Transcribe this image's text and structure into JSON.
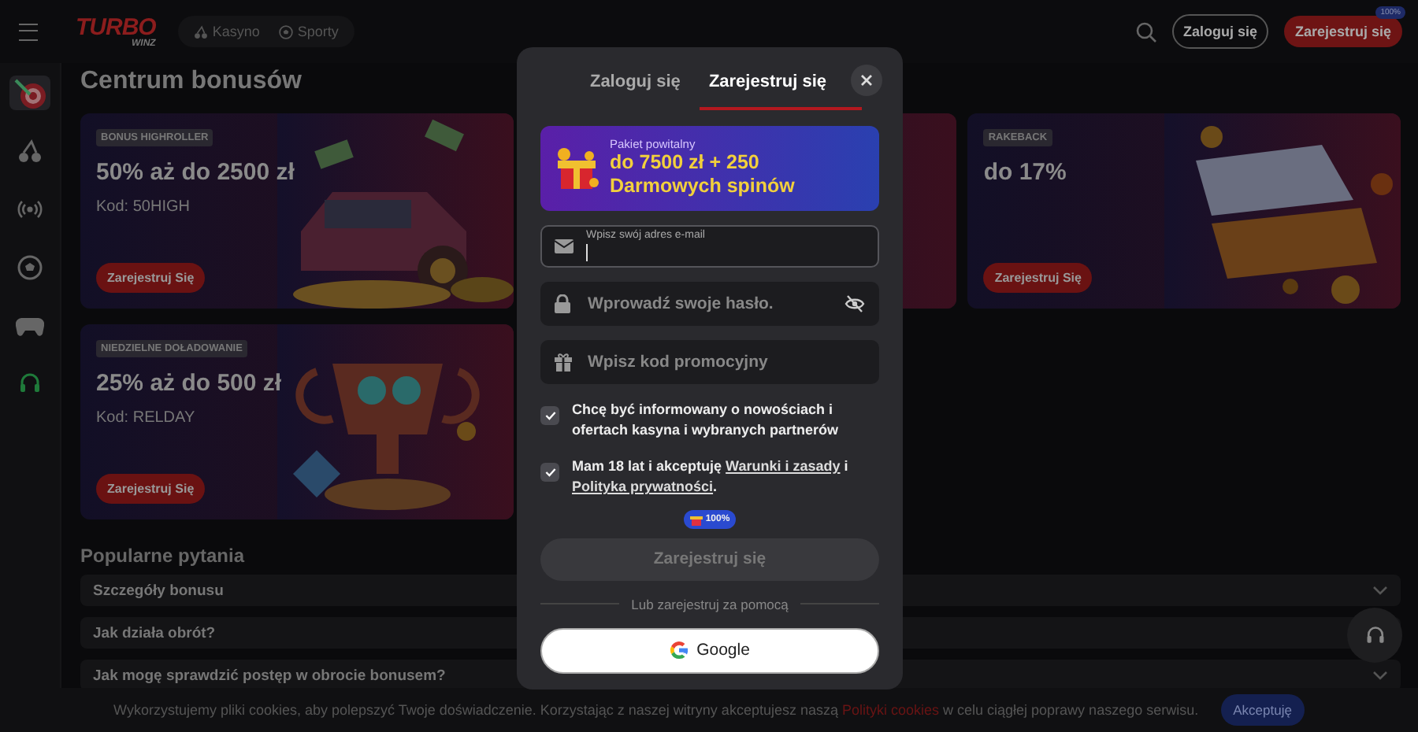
{
  "header": {
    "logo": {
      "top": "TURBO",
      "bottom": "WINZ"
    },
    "nav": [
      {
        "label": "Kasyno",
        "kind": "casino"
      },
      {
        "label": "Sporty",
        "kind": "sport"
      }
    ],
    "login": "Zaloguj się",
    "register": "Zarejestruj się",
    "register_badge": "100%"
  },
  "sidebar": {
    "items": [
      {
        "kind": "target",
        "selected": true
      },
      {
        "kind": "cherries",
        "selected": false
      },
      {
        "kind": "live",
        "selected": false
      },
      {
        "kind": "ball",
        "selected": false
      },
      {
        "kind": "gamepad",
        "selected": false
      },
      {
        "kind": "headset",
        "selected": false
      }
    ]
  },
  "page_title": "Centrum bonusów",
  "cards": [
    {
      "tag": "BONUS HIGHROLLER",
      "title": "50% aż do 2500 zł",
      "code": "Kod: 50HIGH",
      "button": "Zarejestruj Się"
    },
    {
      "kind": "picture"
    },
    {
      "tag": "RAKEBACK",
      "title": "do 17%",
      "button": "Zarejestruj Się"
    },
    {
      "tag": "NIEDZIELNE DOŁADOWANIE",
      "title": "25% aż do 500 zł",
      "code": "Kod: RELDAY",
      "button": "Zarejestruj Się"
    }
  ],
  "faq": {
    "title": "Popularne pytania",
    "items": [
      "Szczegóły bonusu",
      "Jak działa obrót?",
      "Jak mogę sprawdzić postęp w obrocie bonusem?"
    ]
  },
  "cookie_bar": {
    "text_before": "Wykorzystujemy pliki cookies, aby polepszyć Twoje doświadczenie. Korzystając z naszej witryny akceptujesz naszą ",
    "link": "Polityki cookies",
    "text_after": " w celu ciągłej poprawy naszego serwisu.",
    "button": "Akceptuję"
  },
  "modal": {
    "tabs": [
      {
        "label": "Zaloguj się",
        "selected": false
      },
      {
        "label": "Zarejestruj się",
        "selected": true
      }
    ],
    "promo": {
      "label": "Pakiet powitalny",
      "title": "do 7500 zł + 250 Darmowych spinów"
    },
    "fields": [
      {
        "kind": "email",
        "placeholder": "Wpisz swój adres e-mail",
        "focused": true
      },
      {
        "kind": "password",
        "placeholder": "Wprowadź swoje hasło.",
        "focused": false
      },
      {
        "kind": "promo",
        "placeholder": "Wpisz kod promocyjny",
        "focused": false
      }
    ],
    "checkboxes": [
      {
        "checked": true,
        "parts": [
          {
            "text": "Chcę być informowany o nowościach i ofertach kasyna i wybranych partnerów"
          }
        ]
      },
      {
        "checked": true,
        "parts": [
          {
            "text": "Mam 18 lat i akceptuję "
          },
          {
            "link": "Warunki i zasady"
          },
          {
            "text": " i "
          },
          {
            "link": "Polityka prywatności"
          },
          {
            "text": "."
          }
        ]
      }
    ],
    "submit_badge": "100%",
    "submit": {
      "label": "Zarejestruj się",
      "disabled": true
    },
    "divider": "Lub zarejestruj za pomocą",
    "google": "Google"
  }
}
